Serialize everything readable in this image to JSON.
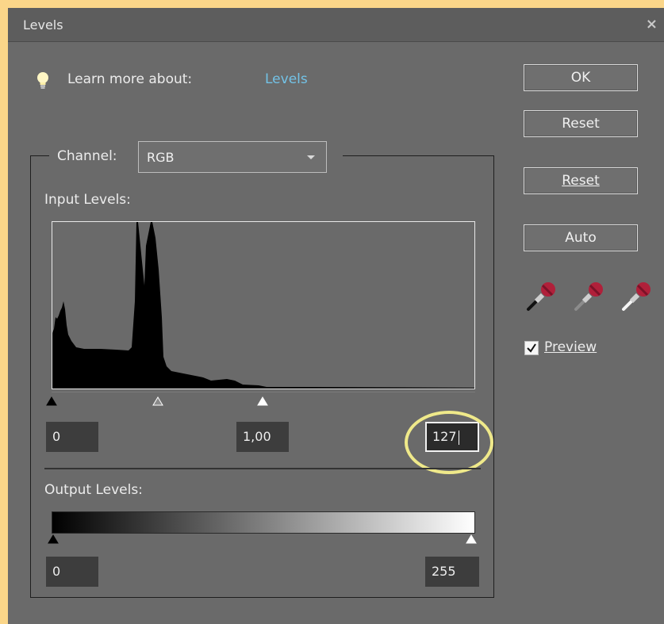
{
  "window": {
    "title": "Levels",
    "close_glyph": "×"
  },
  "help": {
    "text": "Learn more about:",
    "link": "Levels"
  },
  "buttons": {
    "ok": "OK",
    "reset_top": "Reset",
    "reset": "Reset",
    "auto": "Auto"
  },
  "channel": {
    "label": "Channel:",
    "value": "RGB"
  },
  "input_levels": {
    "label": "Input Levels:",
    "black": "0",
    "gamma": "1,00",
    "white": "127"
  },
  "output_levels": {
    "label": "Output Levels:",
    "black": "0",
    "white": "255"
  },
  "preview": {
    "label": "Preview",
    "checked": true
  },
  "eyedroppers": [
    "black-point-eyedropper-icon",
    "gray-point-eyedropper-icon",
    "white-point-eyedropper-icon"
  ],
  "colors": {
    "dialog_bg": "#6a6a6a",
    "link": "#73c2e6",
    "highlight": "#efe98a",
    "eyedropper": "#b0203a"
  }
}
